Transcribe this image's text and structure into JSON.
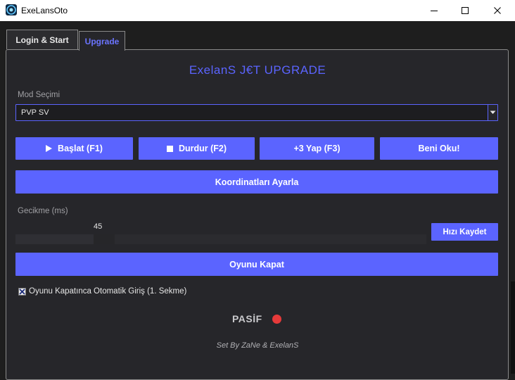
{
  "window": {
    "title": "ExeLansOto",
    "minimize_label": "—",
    "maximize_label": "☐",
    "close_label": "✕"
  },
  "tabs": [
    {
      "label": "Login & Start",
      "selected": false
    },
    {
      "label": "Upgrade",
      "selected": true
    }
  ],
  "header": {
    "title": "ExelanS J€T UPGRADE"
  },
  "mode": {
    "label": "Mod Seçimi",
    "selected": "PVP SV"
  },
  "buttons": {
    "start": "Başlat (F1)",
    "stop": "Durdur (F2)",
    "plus3": "+3 Yap (F3)",
    "readme": "Beni Oku!",
    "coords": "Koordinatları Ayarla",
    "save_speed": "Hızı Kaydet",
    "close_game": "Oyunu Kapat"
  },
  "delay": {
    "label": "Gecikme (ms)",
    "value": "45",
    "fraction": 0.2
  },
  "auto_login": {
    "label": "Oyunu Kapatınca Otomatik Giriş  (1. Sekme)",
    "checked": true
  },
  "status": {
    "text": "PASİF",
    "color": "#e63a3a"
  },
  "footer": {
    "credit": "Set By ZaNe & ExelanS"
  },
  "colors": {
    "accent": "#5b64ff",
    "panel": "#26262a",
    "status_off": "#e63a3a"
  },
  "icons": {
    "start": "play-icon",
    "stop": "stop-icon",
    "dropdown": "chevron-down-icon",
    "checkbox": "checkbox-checked-icon"
  }
}
